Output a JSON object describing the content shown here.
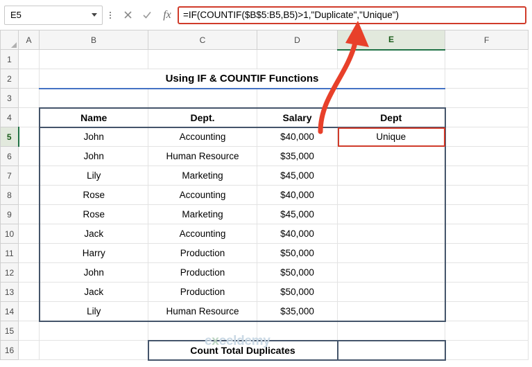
{
  "formula_bar": {
    "name_box_value": "E5",
    "name_box_icon": "chevron-down-icon",
    "menu_icon": "vertical-dots-icon",
    "cancel_icon": "✕",
    "confirm_icon": "✓",
    "fx_icon": "fx",
    "formula_value": "=IF(COUNTIF($B$5:B5,B5)>1,\"Duplicate\",\"Unique\")",
    "formula_placeholder": ""
  },
  "sheet": {
    "column_headers": [
      "A",
      "B",
      "C",
      "D",
      "E",
      "F"
    ],
    "active_column": "E",
    "active_row": "5",
    "row_headers": [
      "1",
      "2",
      "3",
      "4",
      "5",
      "6",
      "7",
      "8",
      "9",
      "10",
      "11",
      "12",
      "13",
      "14",
      "15",
      "16"
    ],
    "title": "Using IF & COUNTIF Functions",
    "table_headers": [
      "Name",
      "Dept.",
      "Salary",
      "Dept"
    ],
    "rows": [
      {
        "name": "John",
        "dept": "Accounting",
        "salary": "$40,000",
        "result": "Unique"
      },
      {
        "name": "John",
        "dept": "Human Resource",
        "salary": "$35,000",
        "result": ""
      },
      {
        "name": "Lily",
        "dept": "Marketing",
        "salary": "$45,000",
        "result": ""
      },
      {
        "name": "Rose",
        "dept": "Accounting",
        "salary": "$40,000",
        "result": ""
      },
      {
        "name": "Rose",
        "dept": "Marketing",
        "salary": "$45,000",
        "result": ""
      },
      {
        "name": "Jack",
        "dept": "Accounting",
        "salary": "$40,000",
        "result": ""
      },
      {
        "name": "Harry",
        "dept": "Production",
        "salary": "$50,000",
        "result": ""
      },
      {
        "name": "John",
        "dept": "Production",
        "salary": "$50,000",
        "result": ""
      },
      {
        "name": "Jack",
        "dept": "Production",
        "salary": "$50,000",
        "result": ""
      },
      {
        "name": "Lily",
        "dept": "Human Resource",
        "salary": "$35,000",
        "result": ""
      }
    ],
    "count_label": "Count Total Duplicates",
    "count_value": ""
  },
  "annotations": {
    "arrow_icon": "red-arrow-up",
    "arrow_color": "#e8402a"
  },
  "watermark": {
    "text_before": "e",
    "text_x": "x",
    "text_after": "celdemy"
  },
  "colors": {
    "table_border": "#44546a",
    "title": "#1f3864",
    "accent_red": "#d03b2a",
    "header_active": "#217346"
  }
}
